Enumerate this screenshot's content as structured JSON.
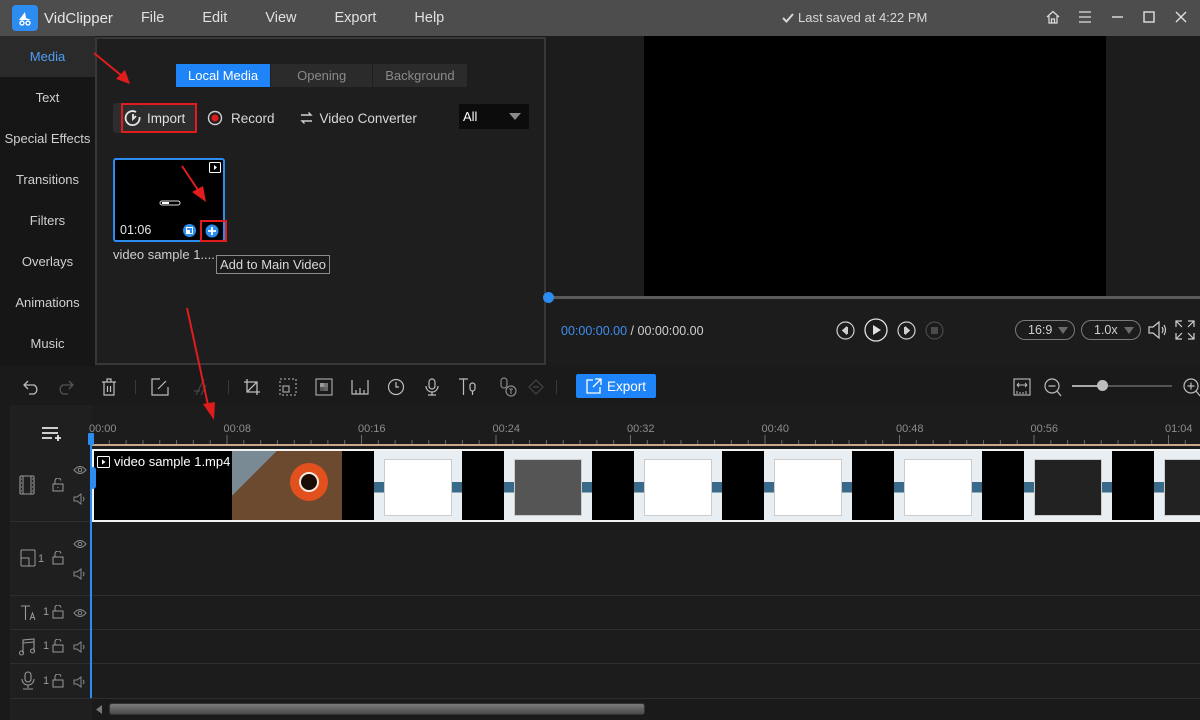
{
  "app": {
    "name": "VidClipper",
    "menu": [
      "File",
      "Edit",
      "View",
      "Export",
      "Help"
    ],
    "save_status": "Last saved at 4:22 PM",
    "accent_color": "#1e84f7"
  },
  "window_controls": [
    "home-icon",
    "menu-icon",
    "minimize-icon",
    "maximize-icon",
    "close-icon"
  ],
  "sidebar": {
    "items": [
      {
        "label": "Media",
        "active": true
      },
      {
        "label": "Text"
      },
      {
        "label": "Special Effects"
      },
      {
        "label": "Transitions"
      },
      {
        "label": "Filters"
      },
      {
        "label": "Overlays"
      },
      {
        "label": "Animations"
      },
      {
        "label": "Music"
      }
    ]
  },
  "media_panel": {
    "tabs": [
      {
        "label": "Local Media",
        "active": true
      },
      {
        "label": "Opening"
      },
      {
        "label": "Background"
      }
    ],
    "import_label": "Import",
    "record_label": "Record",
    "converter_label": "Video Converter",
    "filter_value": "All",
    "items": [
      {
        "name": "video sample 1....",
        "duration": "01:06"
      }
    ],
    "tooltip": "Add to Main Video"
  },
  "preview": {
    "current_time": "00:00:00.00",
    "separator": "/",
    "total_time": "00:00:00.00",
    "aspect_ratio": "16:9",
    "speed": "1.0x",
    "progress": 0
  },
  "timeline_toolbar": {
    "export_label": "Export",
    "zoom_level": 0.3
  },
  "timeline": {
    "ruler_labels": [
      "00:00",
      "00:08",
      "00:16",
      "00:24",
      "00:32",
      "00:40",
      "00:48",
      "00:56",
      "01:04"
    ],
    "main_clip": {
      "name": "video sample 1.mp4"
    },
    "track_counts": {
      "pip": "1",
      "text": "1",
      "music": "1",
      "voice": "1"
    }
  }
}
